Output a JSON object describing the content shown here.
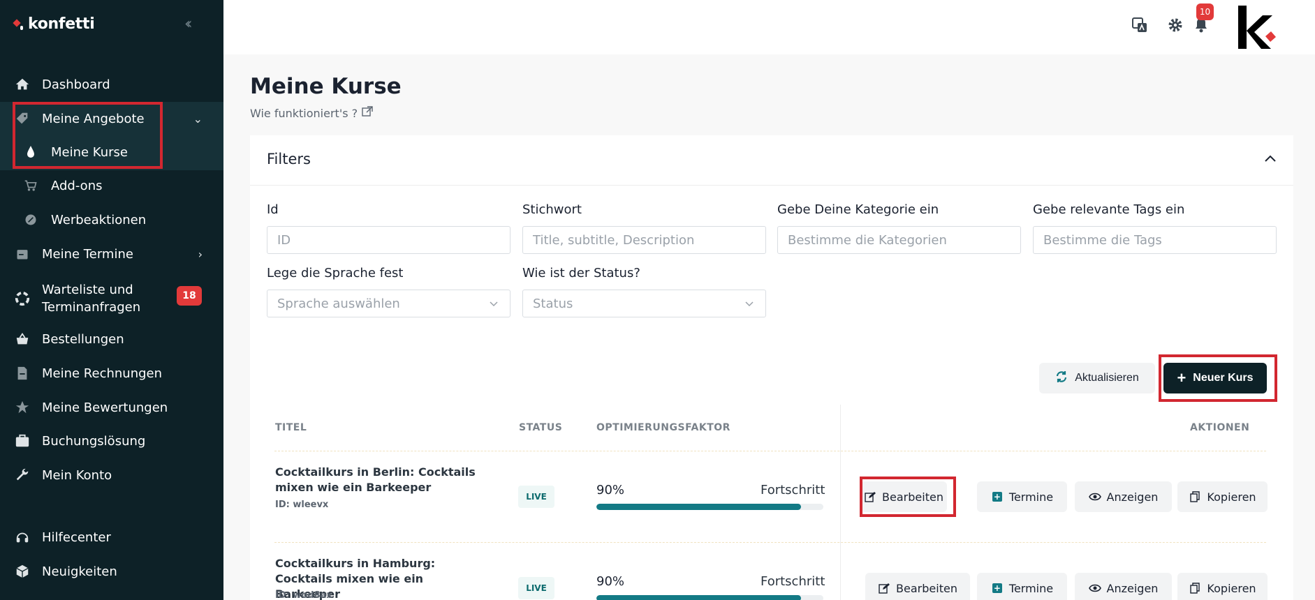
{
  "brand": {
    "name": "konfetti"
  },
  "sidebar": {
    "items": [
      {
        "label": "Dashboard",
        "icon": "home-icon"
      },
      {
        "label": "Meine Angebote",
        "icon": "tag-icon"
      },
      {
        "label": "Meine Kurse",
        "icon": "drop-icon"
      },
      {
        "label": "Add-ons",
        "icon": "cart-icon"
      },
      {
        "label": "Werbeaktionen",
        "icon": "percent-badge-icon"
      },
      {
        "label": "Meine Termine",
        "icon": "calendar-icon"
      },
      {
        "label": "Warteliste und",
        "label2": "Terminanfragen",
        "icon": "lifebuoy-icon",
        "badge": "18"
      },
      {
        "label": "Bestellungen",
        "icon": "basket-icon"
      },
      {
        "label": "Meine Rechnungen",
        "icon": "invoice-icon"
      },
      {
        "label": "Meine Bewertungen",
        "icon": "star-icon"
      },
      {
        "label": "Buchungslösung",
        "icon": "briefcase-icon"
      },
      {
        "label": "Mein Konto",
        "icon": "wrench-icon"
      },
      {
        "label": "Hilfecenter",
        "icon": "headset-icon"
      },
      {
        "label": "Neuigkeiten",
        "icon": "box-icon"
      }
    ]
  },
  "topbar": {
    "notifications": "10"
  },
  "page": {
    "title": "Meine Kurse",
    "help": "Wie funktioniert's ?"
  },
  "filters": {
    "title": "Filters",
    "id_label": "Id",
    "id_placeholder": "ID",
    "keyword_label": "Stichwort",
    "keyword_placeholder": "Title, subtitle, Description",
    "category_label": "Gebe Deine Kategorie ein",
    "category_placeholder": "Bestimme die Kategorien",
    "tags_label": "Gebe relevante Tags ein",
    "tags_placeholder": "Bestimme die Tags",
    "language_label": "Lege die Sprache fest",
    "language_placeholder": "Sprache auswählen",
    "status_label": "Wie ist der Status?",
    "status_placeholder": "Status"
  },
  "buttons": {
    "refresh": "Aktualisieren",
    "new_course": "Neuer Kurs"
  },
  "table": {
    "headers": {
      "title": "TITEL",
      "status": "STATUS",
      "optimization": "OPTIMIERUNGSFAKTOR",
      "actions": "AKTIONEN"
    },
    "rows": [
      {
        "title": "Cocktailkurs in Berlin: Cocktails mixen wie ein Barkeeper",
        "id": "ID: wleevx",
        "status": "LIVE",
        "percent": "90%",
        "progress": 0.9,
        "progress_label": "Fortschritt",
        "actions": {
          "edit": "Bearbeiten",
          "dates": "Termine",
          "view": "Anzeigen",
          "copy": "Kopieren"
        }
      },
      {
        "title": "Cocktailkurs in Hamburg: Cocktails mixen wie ein Barkeeper",
        "id": "ID: wod8ax",
        "status": "LIVE",
        "percent": "90%",
        "progress": 0.9,
        "progress_label": "Fortschritt",
        "actions": {
          "edit": "Bearbeiten",
          "dates": "Termine",
          "view": "Anzeigen",
          "copy": "Kopieren"
        }
      }
    ]
  }
}
